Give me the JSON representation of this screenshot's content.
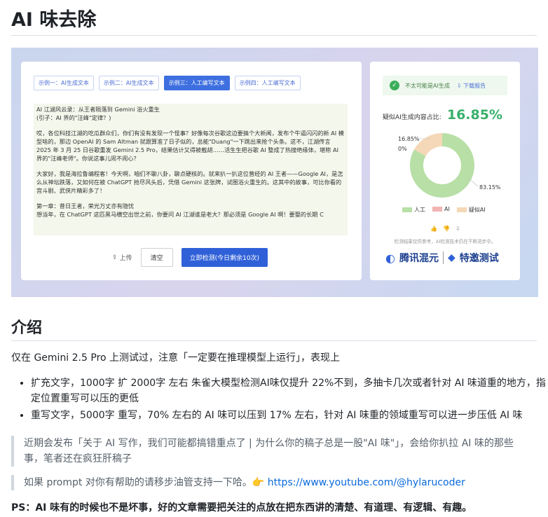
{
  "title": "AI 味去除",
  "screenshot": {
    "tabs": [
      {
        "label": "示例一：AI生成文本",
        "active": false
      },
      {
        "label": "示例二：AI生成文本",
        "active": false
      },
      {
        "label": "示例三：人工编写文本",
        "active": true
      },
      {
        "label": "示例四：人工编写文本",
        "active": false
      }
    ],
    "text_paragraphs": [
      "AI 江湖风云录：从王者陨落到 Gemini 浴火重生\n(引子：AI 界的\"汪峰\"定律？)",
      "哎，各位科技江湖的吃瓜群众们，你们有没有发现一个怪事？好像每次谷歌这边要搞个大新闻，发布个牛逼闪闪的新 AI 模型啥的，那边 OpenAI 的 Sam Altman 就跟算准了日子似的，总能\"Duang\"一下跳出来抢个头条。这不，江湖传言 2025 年 3 月 25 日谷歌重发 Gemini 2.5 Pro，结果估计又得被截胡……活生生把谷歌 AI 整成了热搜绝缘体，堪称 AI 界的\"汪峰老师\"。你说这事儿闹不闹心？",
      "大家好，我是海拉鲁编程客！今天啊，咱们不聊八卦，聊点硬核的。就来扒一扒这位曾经的 AI 王者——Google AI，是怎么从神坛跌落，又如何在被 ChatGPT 抢尽风头后，凭借 Gemini 这张牌，试图浴火重生的。这其中的故事，可比你看的宫斗剧、武侠片精彩多了！",
      "第一章：昔日王者，荣光万丈亦有隐忧\n想当年，在 ChatGPT 这匹黑马横空出世之前，你要问 AI 江湖谁是老大？那必须是 Google AI 啊！要娶的长期 C"
    ],
    "upload_label": "上传",
    "clear_label": "清空",
    "detect_label": "立即检测(今日剩余10次)",
    "status_text": "不太可能是AI生成",
    "download_label": "下载报告",
    "ratio_label": "疑似AI生成内容占比:",
    "ratio_value": "16.85%",
    "pie_labels": {
      "top": "16.85%",
      "mid": "0%",
      "bottom": "83.15%"
    },
    "legend": [
      "人工",
      "AI",
      "疑似AI"
    ],
    "disclaimer": "检测结果仅供参考，AI检测技术仍在不断进步中。",
    "logo_left": "腾讯混元",
    "logo_right": "特邀测试",
    "colors": {
      "human": "#b7dfa6",
      "ai": "#f2b3b3",
      "suspect_ai": "#f5d8b8",
      "accent": "#2f60d8",
      "ratio": "#38b06a"
    }
  },
  "chart_data": {
    "type": "pie",
    "categories": [
      "人工",
      "AI",
      "疑似AI"
    ],
    "values": [
      83.15,
      0,
      16.85
    ]
  },
  "intro_heading": "介绍",
  "intro_text": "仅在 Gemini 2.5 Pro 上测试过，注意「一定要在推理模型上运行」，表现上",
  "bullets": [
    "扩充文字，1000字 扩 2000字 左右 朱雀大模型检测AI味仅提升 22%不到，多抽卡几次或者针对 AI 味道重的地方，指定位置重写可以压的更低",
    "重写文字，5000字 重写，70% 左右的 AI 味可以压到 17% 左右，针对 AI 味重的领域重写可以进一步压低 AI 味"
  ],
  "quote1": "近期会发布「关于 AI 写作，我们可能都搞错重点了 | 为什么你的稿子总是一股\"AI 味\"」，会给你扒拉 AI 味的那些事，笔者还在疯狂肝稿子",
  "quote2_text": "如果 prompt 对你有帮助的请移步油管支持一下哈。👉 ",
  "quote2_link": "https://www.youtube.com/@hylarucoder",
  "ps": "PS：AI 味有的时候也不是坏事，好的文章需要把关注的点放在把东西讲的清楚、有道理、有逻辑、有趣。"
}
